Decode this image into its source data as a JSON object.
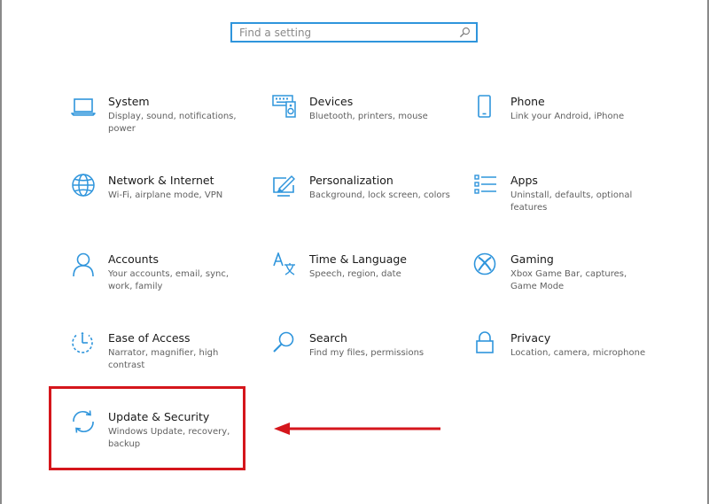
{
  "search": {
    "placeholder": "Find a setting"
  },
  "tiles": [
    {
      "title": "System",
      "desc": "Display, sound, notifications, power",
      "icon": "laptop-icon"
    },
    {
      "title": "Devices",
      "desc": "Bluetooth, printers, mouse",
      "icon": "devices-icon"
    },
    {
      "title": "Phone",
      "desc": "Link your Android, iPhone",
      "icon": "phone-icon"
    },
    {
      "title": "Network & Internet",
      "desc": "Wi-Fi, airplane mode, VPN",
      "icon": "globe-icon"
    },
    {
      "title": "Personalization",
      "desc": "Background, lock screen, colors",
      "icon": "paintbrush-icon"
    },
    {
      "title": "Apps",
      "desc": "Uninstall, defaults, optional features",
      "icon": "apps-list-icon"
    },
    {
      "title": "Accounts",
      "desc": "Your accounts, email, sync, work, family",
      "icon": "person-icon"
    },
    {
      "title": "Time & Language",
      "desc": "Speech, region, date",
      "icon": "time-language-icon"
    },
    {
      "title": "Gaming",
      "desc": "Xbox Game Bar, captures, Game Mode",
      "icon": "xbox-icon"
    },
    {
      "title": "Ease of Access",
      "desc": "Narrator, magnifier, high contrast",
      "icon": "ease-of-access-icon"
    },
    {
      "title": "Search",
      "desc": "Find my files, permissions",
      "icon": "search-icon"
    },
    {
      "title": "Privacy",
      "desc": "Location, camera, microphone",
      "icon": "lock-icon"
    },
    {
      "title": "Update & Security",
      "desc": "Windows Update, recovery, backup",
      "icon": "sync-icon"
    }
  ],
  "colors": {
    "accent": "#2f95dc",
    "annotation": "#d5161c"
  }
}
